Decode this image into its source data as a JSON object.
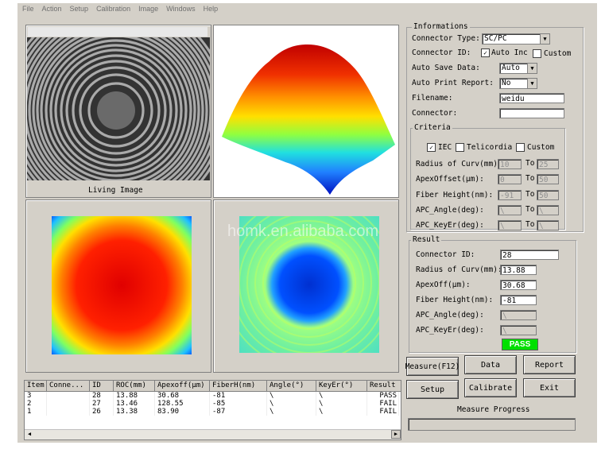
{
  "menu": [
    "File",
    "Action",
    "Setup",
    "Calibration",
    "Image",
    "Windows",
    "Help"
  ],
  "living_image_label": "Living Image",
  "watermark": "homk.en.alibaba.com",
  "informations": {
    "title": "Informations",
    "connector_type_label": "Connector Type:",
    "connector_type_value": "SC/PC",
    "connector_id_label": "Connector ID:",
    "auto_inc_label": "Auto Inc",
    "custom_label": "Custom",
    "auto_save_label": "Auto Save Data:",
    "auto_save_value": "Auto",
    "auto_print_label": "Auto Print Report:",
    "auto_print_value": "No",
    "filename_label": "Filename:",
    "filename_value": "weidu",
    "connector_label": "Connector:",
    "connector_value": ""
  },
  "criteria": {
    "title": "Criteria",
    "iec_label": "IEC",
    "telicordia_label": "Telicordia",
    "custom_label": "Custom",
    "to_label": "To",
    "rows": [
      {
        "label": "Radius of Curv(mm):",
        "from": "10",
        "to": "25"
      },
      {
        "label": "ApexOffset(μm):",
        "from": "0",
        "to": "50"
      },
      {
        "label": "Fiber Height(nm):",
        "from": "-91",
        "to": "50"
      },
      {
        "label": "APC_Angle(deg):",
        "from": "\\",
        "to": "\\"
      },
      {
        "label": "APC_KeyEr(deg):",
        "from": "\\",
        "to": "\\"
      }
    ]
  },
  "result": {
    "title": "Result",
    "rows": [
      {
        "label": "Connector ID:",
        "value": "28"
      },
      {
        "label": "Radius of Curv(mm):",
        "value": "13.88"
      },
      {
        "label": "ApexOff(μm):",
        "value": "30.68"
      },
      {
        "label": "Fiber Height(nm):",
        "value": "-81"
      },
      {
        "label": "APC_Angle(deg):",
        "value": "\\"
      },
      {
        "label": "APC_KeyEr(deg):",
        "value": "\\"
      }
    ],
    "status": "PASS",
    "status_color": "#00e000"
  },
  "buttons": {
    "measure": "Measure(F12)",
    "data": "Data",
    "report": "Report",
    "setup": "Setup",
    "calibrate": "Calibrate",
    "exit": "Exit"
  },
  "measure_progress_label": "Measure Progress",
  "table": {
    "headers": [
      "Item",
      "Conne...",
      "ID",
      "ROC(mm)",
      "Apexoff(μm)",
      "FiberH(nm)",
      "Angle(°)",
      "KeyEr(°)",
      "Result"
    ],
    "rows": [
      [
        "3",
        "",
        "28",
        "13.88",
        "30.68",
        "-81",
        "\\",
        "\\",
        "PASS"
      ],
      [
        "2",
        "",
        "27",
        "13.46",
        "128.55",
        "-85",
        "\\",
        "\\",
        "FAIL"
      ],
      [
        "1",
        "",
        "26",
        "13.38",
        "83.90",
        "-87",
        "\\",
        "\\",
        "FAIL"
      ]
    ]
  }
}
